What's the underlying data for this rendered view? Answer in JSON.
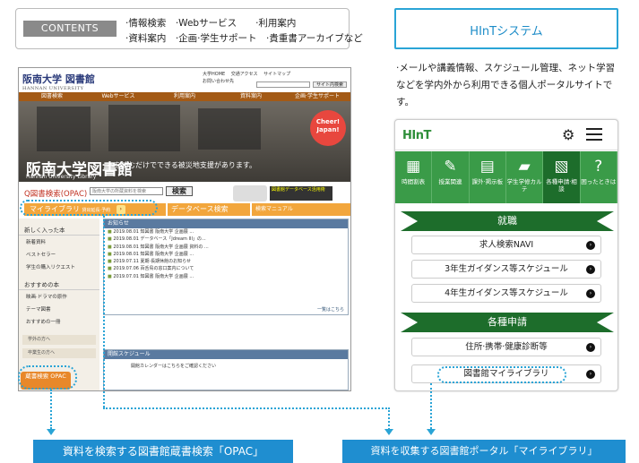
{
  "contents": {
    "tag": "CONTENTS",
    "line1": "·情報検索　·Webサービス　　·利用案内",
    "line2": "·資料案内　·企画·学生サポート　·貴重書アーカイブなど"
  },
  "hint_title": "HInTシステム",
  "hint_desc": "·メールや講義情報、スケジュール管理、ネット学習などを学内外から利用できる個人ポータルサイトです。",
  "library_site": {
    "logo": "阪南大学 図書館",
    "logo_en": "HANNAN UNIVERSITY",
    "header_links": [
      "大学HOME",
      "交通アクセス",
      "サイトマップ",
      "お問い合わせ先"
    ],
    "search_button": "サイト内検索",
    "nav": [
      "図書検索",
      "Webサービス",
      "利用案内",
      "資料案内",
      "企画·学生サポート"
    ],
    "hero_title": "阪南大学図書館",
    "hero_sub": "Hannan University Library",
    "hero_copy": "本を読むだけでできる被災地支援があります。",
    "cheer": "Cheer! Japan!",
    "opac_label": "Q図書検索(OPAC)",
    "opac_placeholder": "阪南大学の所蔵資料を検索",
    "opac_button": "検索",
    "db_banner": "図書館データベース活用術",
    "tab_mylib": "マイライブラリ",
    "tab_mylib_sub": "貸出延長·予約",
    "tab_db": "データベース検索",
    "tab_manual": "検索マニュアル",
    "side_head1": "新しく入った本",
    "side_items1": [
      "新着資料",
      "ベストセラー",
      "学生の購入リクエスト"
    ],
    "side_head2": "おすすめの本",
    "side_items2": [
      "映画·ドラマの原作",
      "テーマ図書",
      "おすすめの一冊"
    ],
    "side_btn1": "学外の方へ",
    "side_btn2": "卒業生の方へ",
    "opac_side_btn": "蔵書検索 OPAC",
    "news_head": "お知らせ",
    "news": [
      "2019.08.01 知図書 阪南大学 企画展 ...",
      "2019.08.01 データベース「Jdream III」の...",
      "2019.08.01 知図書 阪南大学 企画展 資料の ...",
      "2019.08.01 知図書 阪南大学 企画展 ...",
      "2019.07.11 夏期·長期休館のお知らせ",
      "2019.07.06 百舌鳥の窓口案内について",
      "2019.07.01 知図書 阪南大学 企画展 ..."
    ],
    "news_more": "一覧はこちら",
    "sched_head": "開館スケジュール",
    "sched_text": "開館カレンダーはこちらをご確認ください"
  },
  "hint_app": {
    "logo": "HInT",
    "tiles": [
      {
        "icon": "▦",
        "label": "時間割表"
      },
      {
        "icon": "✎",
        "label": "授業関連"
      },
      {
        "icon": "▤",
        "label": "課外·掲示板"
      },
      {
        "icon": "▰",
        "label": "学生学修カルテ"
      },
      {
        "icon": "▧",
        "label": "各種申請·相談"
      },
      {
        "icon": "?",
        "label": "困ったときは"
      }
    ],
    "section1": "就職",
    "items1": [
      "求人検索NAVI",
      "3年生ガイダンス等スケジュール",
      "4年生ガイダンス等スケジュール"
    ],
    "section2": "各種申請",
    "items2": [
      "住所·携帯·健康診断等",
      "図書館マイライブラリ"
    ]
  },
  "bottom_left": "資料を検索する図書館蔵書検索「OPAC」",
  "bottom_right": "資料を収集する図書館ポータル「マイライブラリ」"
}
